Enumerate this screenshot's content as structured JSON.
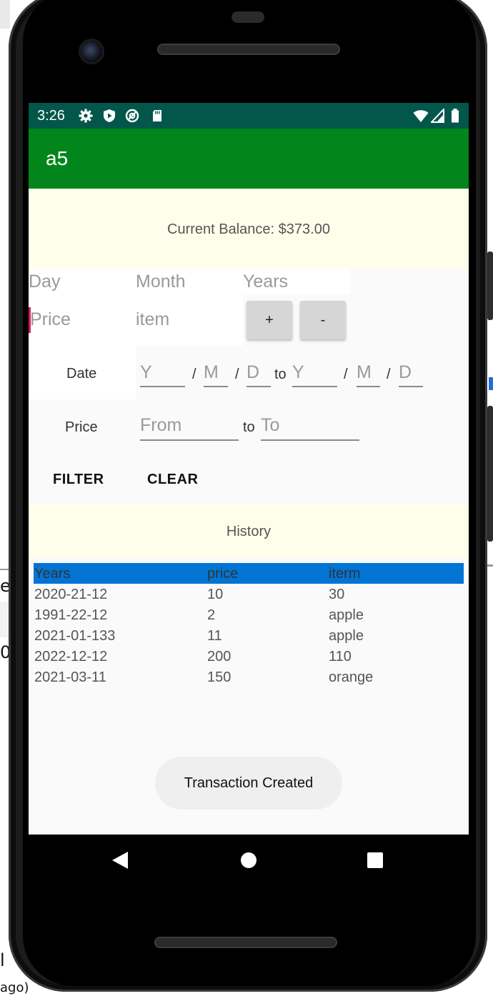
{
  "status_bar": {
    "time": "3:26",
    "left_icons": [
      "settings-icon",
      "shield-play-icon",
      "at-sign-icon",
      "sd-card-icon"
    ],
    "right_icons": [
      "wifi-icon",
      "signal-icon",
      "battery-icon"
    ],
    "color": "#02574a"
  },
  "app_bar": {
    "title": "a5",
    "color": "#02861c"
  },
  "balance": {
    "text": "Current Balance: $373.00"
  },
  "entry": {
    "day_placeholder": "Day",
    "month_placeholder": "Month",
    "years_placeholder": "Years",
    "price_placeholder": "Price",
    "item_placeholder": "item",
    "add_label": "+",
    "subtract_label": "-"
  },
  "date_filter": {
    "label": "Date",
    "from_year": "Y",
    "from_month": "M",
    "from_day": "D",
    "to_label": "to",
    "to_year": "Y",
    "to_month": "M",
    "to_day": "D",
    "slash": "/"
  },
  "price_filter": {
    "label": "Price",
    "from_placeholder": "From",
    "to_label": "to",
    "to_placeholder": "To"
  },
  "actions": {
    "filter_label": "FILTER",
    "clear_label": "CLEAR"
  },
  "history": {
    "title": "History",
    "columns": [
      "Years",
      "price",
      "iterm"
    ],
    "header_color": "#0274d4",
    "rows": [
      [
        "2020-21-12",
        "10",
        "30"
      ],
      [
        "1991-22-12",
        "2",
        "apple"
      ],
      [
        "2021-01-133",
        "11",
        "apple"
      ],
      [
        "2022-12-12",
        "200",
        "110"
      ],
      [
        "2021-03-11",
        "150",
        "orange"
      ]
    ]
  },
  "toast": {
    "text": "Transaction Created"
  },
  "nav_bar": {
    "icons": [
      "back-icon",
      "home-icon",
      "recents-icon"
    ]
  },
  "background": {
    "edge_text_1": "e",
    "edge_text_2": "0",
    "edge_text_3": "l",
    "edge_text_4": "ago)"
  }
}
